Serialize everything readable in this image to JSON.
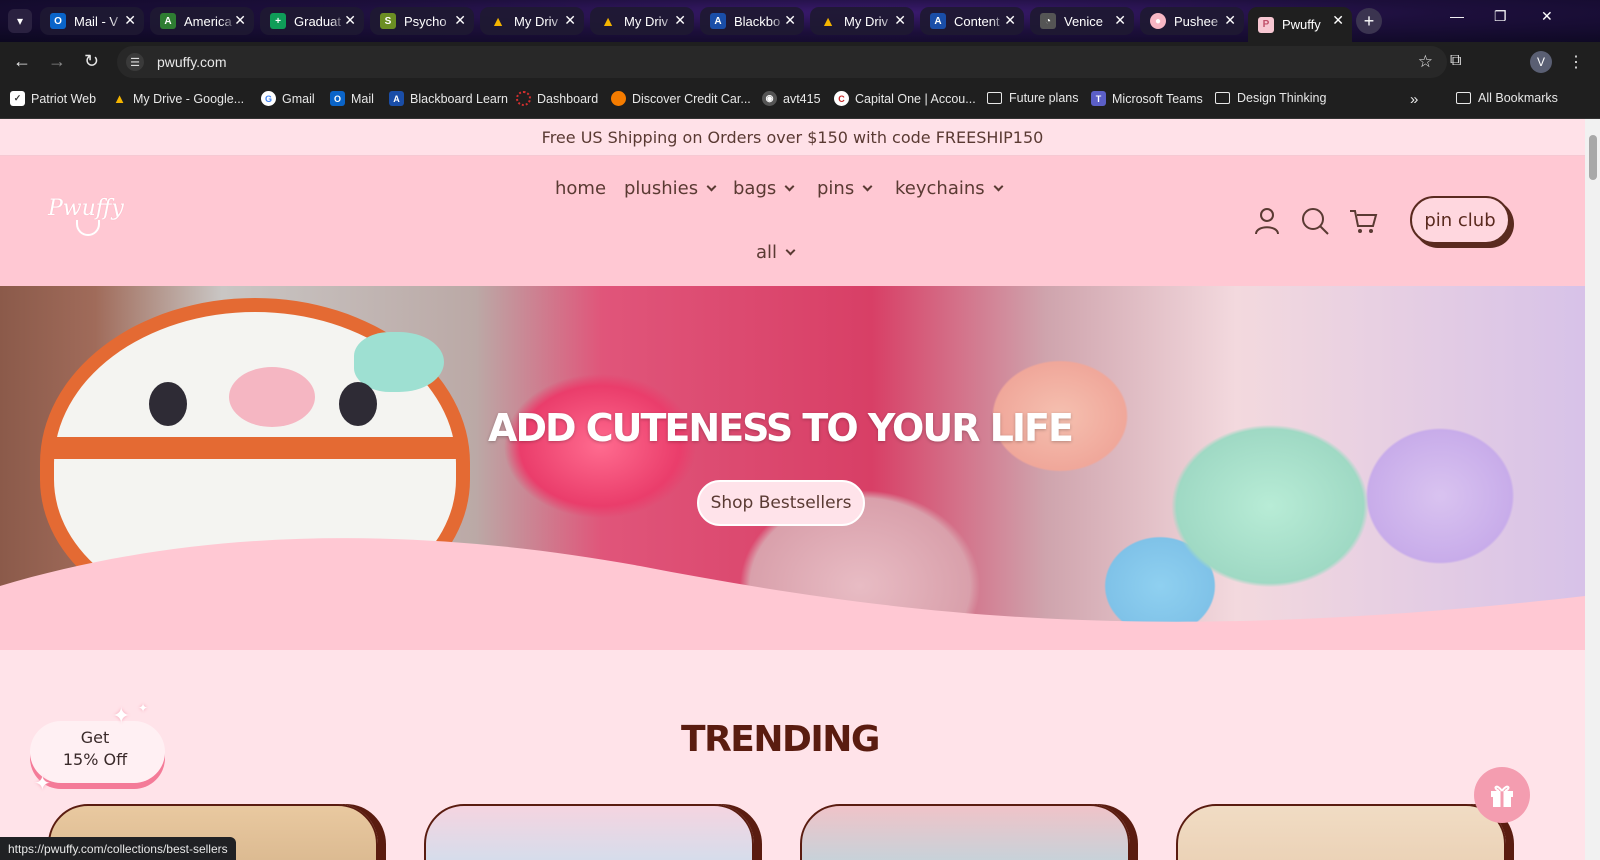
{
  "browser": {
    "tabs": [
      {
        "title": "Mail - V",
        "favicon_color": "#0a64c8",
        "favicon_glyph": "O"
      },
      {
        "title": "America",
        "favicon_color": "#2e7d32",
        "favicon_glyph": "A"
      },
      {
        "title": "Graduat",
        "favicon_color": "#0f9d58",
        "favicon_glyph": "+"
      },
      {
        "title": "Psycho",
        "favicon_color": "#6b8e23",
        "favicon_glyph": "S"
      },
      {
        "title": "My Driv",
        "favicon_color": "#f4b400",
        "favicon_glyph": "▲"
      },
      {
        "title": "My Driv",
        "favicon_color": "#f4b400",
        "favicon_glyph": "▲"
      },
      {
        "title": "Blackbo",
        "favicon_color": "#1a4ea8",
        "favicon_glyph": "A"
      },
      {
        "title": "My Driv",
        "favicon_color": "#f4b400",
        "favicon_glyph": "▲"
      },
      {
        "title": "Content",
        "favicon_color": "#1a4ea8",
        "favicon_glyph": "A"
      },
      {
        "title": "Venice",
        "favicon_color": "#555555",
        "favicon_glyph": "◔"
      },
      {
        "title": "Pushee",
        "favicon_color": "#f7b6c4",
        "favicon_glyph": "●"
      },
      {
        "title": "Pwuffy",
        "favicon_color": "#f7c7d2",
        "favicon_glyph": "P"
      }
    ],
    "url": "pwuffy.com",
    "profile_initial": "V",
    "bookmarks": [
      {
        "label": "Patriot Web",
        "color": "#ffffff",
        "glyph": "✓"
      },
      {
        "label": "My Drive - Google...",
        "color": "#f4b400",
        "glyph": "▲"
      },
      {
        "label": "Gmail",
        "color": "#ffffff",
        "glyph": "G"
      },
      {
        "label": "Mail",
        "color": "#0a64c8",
        "glyph": "O"
      },
      {
        "label": "Blackboard Learn",
        "color": "#1a4ea8",
        "glyph": "A"
      },
      {
        "label": "Dashboard",
        "color": "#d32f2f",
        "glyph": "◌"
      },
      {
        "label": "Discover Credit Car...",
        "color": "#f57c00",
        "glyph": "●"
      },
      {
        "label": "avt415",
        "color": "#555555",
        "glyph": "◉"
      },
      {
        "label": "Capital One | Accou...",
        "color": "#c62828",
        "glyph": "C"
      },
      {
        "label": "Future plans",
        "color": "",
        "glyph": "folder"
      },
      {
        "label": "Microsoft Teams",
        "color": "#5b5fc7",
        "glyph": "T"
      },
      {
        "label": "Design Thinking",
        "color": "",
        "glyph": "folder"
      }
    ],
    "all_bookmarks": "All Bookmarks",
    "status_url": "https://pwuffy.com/collections/best-sellers"
  },
  "site": {
    "announcement": "Free US Shipping on Orders over $150 with code FREESHIP150",
    "logo": "Pwuffy",
    "nav": {
      "home": "home",
      "plushies": "plushies",
      "bags": "bags",
      "pins": "pins",
      "keychains": "keychains",
      "all": "all"
    },
    "pin_club": "pin club",
    "hero": {
      "title": "ADD CUTENESS TO YOUR LIFE",
      "button": "Shop Bestsellers"
    },
    "trending_heading": "TRENDING",
    "promo": {
      "line1": "Get",
      "line2": "15% Off"
    }
  },
  "colors": {
    "pink_header": "#ffc8d3",
    "page_bg": "#ffe3e9",
    "brown_accent": "#5a1c10"
  }
}
